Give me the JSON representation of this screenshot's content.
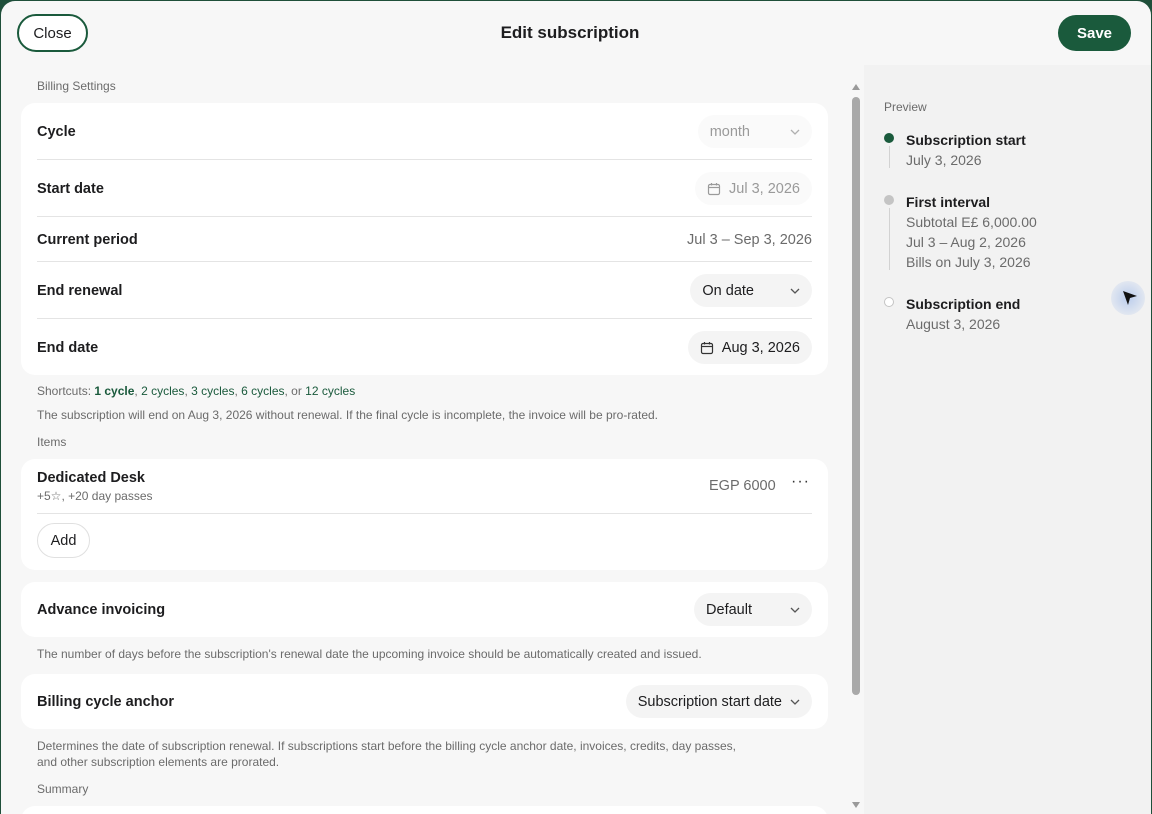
{
  "header": {
    "close_label": "Close",
    "title": "Edit subscription",
    "save_label": "Save"
  },
  "billing": {
    "section_label": "Billing Settings",
    "cycle": {
      "label": "Cycle",
      "value": "month"
    },
    "start_date": {
      "label": "Start date",
      "value": "Jul 3, 2026"
    },
    "current_period": {
      "label": "Current period",
      "value": "Jul 3 – Sep 3, 2026"
    },
    "end_renewal": {
      "label": "End renewal",
      "value": "On date"
    },
    "end_date": {
      "label": "End date",
      "value": "Aug 3, 2026"
    },
    "shortcuts": {
      "prefix": "Shortcuts: ",
      "items": [
        "1 cycle",
        "2 cycles",
        "3 cycles",
        "6 cycles",
        "12 cycles"
      ],
      "sep": ", ",
      "or": ", or "
    },
    "note": "The subscription will end on Aug 3, 2026 without renewal. If the final cycle is incomplete, the invoice will be pro-rated."
  },
  "items": {
    "section_label": "Items",
    "list": [
      {
        "name": "Dedicated Desk",
        "detail": "+5☆, +20 day passes",
        "price": "EGP 6000"
      }
    ],
    "add_label": "Add"
  },
  "advance_invoicing": {
    "label": "Advance invoicing",
    "value": "Default",
    "help": "The number of days before the subscription's renewal date the upcoming invoice should be automatically created and issued."
  },
  "billing_anchor": {
    "label": "Billing cycle anchor",
    "value": "Subscription start date",
    "help_line1": "Determines the date of subscription renewal. If subscriptions start before the billing cycle anchor date, invoices, credits, day passes,",
    "help_line2": "and other subscription elements are prorated."
  },
  "summary": {
    "section_label": "Summary"
  },
  "preview": {
    "label": "Preview",
    "start": {
      "title": "Subscription start",
      "date": "July 3, 2026"
    },
    "first_interval": {
      "title": "First interval",
      "subtotal": "Subtotal E£ 6,000.00",
      "period": "Jul 3 – Aug 2, 2026",
      "bills": "Bills on July 3, 2026"
    },
    "end": {
      "title": "Subscription end",
      "date": "August 3, 2026"
    }
  },
  "colors": {
    "accent": "#1a5a3c",
    "dot_done": "#1a5a3c",
    "dot_pending": "#c4c4c4"
  }
}
